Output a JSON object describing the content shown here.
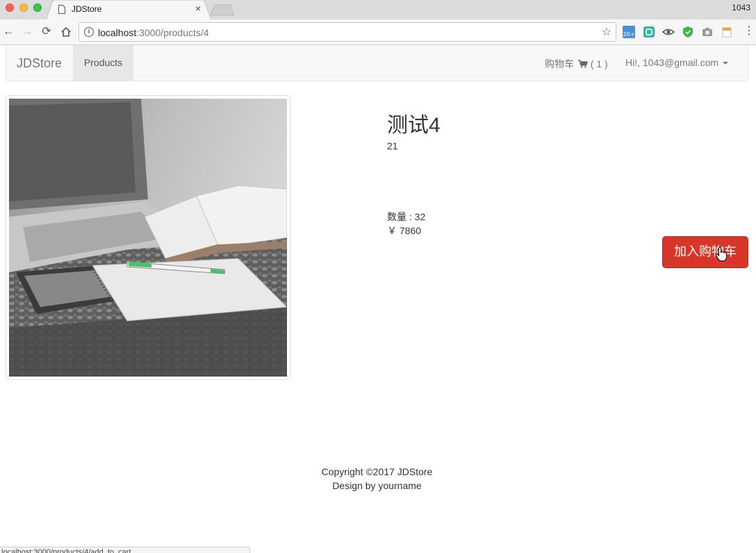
{
  "browser": {
    "tab_title": "JDStore",
    "tab_close": "×",
    "user_badge": "1043",
    "url_host": "localhost",
    "url_rest": ":3000/products/4",
    "status_url": "localhost:3000/products/4/add_to_cart"
  },
  "navbar": {
    "brand": "JDStore",
    "products": "Products",
    "cart_label": "购物车",
    "cart_count": "( 1 )",
    "user_greeting": "Hi!, 1043@gmail.com"
  },
  "product": {
    "title": "测试4",
    "description": "21",
    "quantity": "数量 : 32",
    "price": "￥ 7860",
    "add_to_cart": "加入购物车",
    "image_alt": "laptop-notebook-photo"
  },
  "footer": {
    "copyright": "Copyright ©2017 JDStore",
    "design": "Design by yourname"
  },
  "colors": {
    "accent": "#d9362b",
    "navbar_bg": "#f8f8f8"
  }
}
